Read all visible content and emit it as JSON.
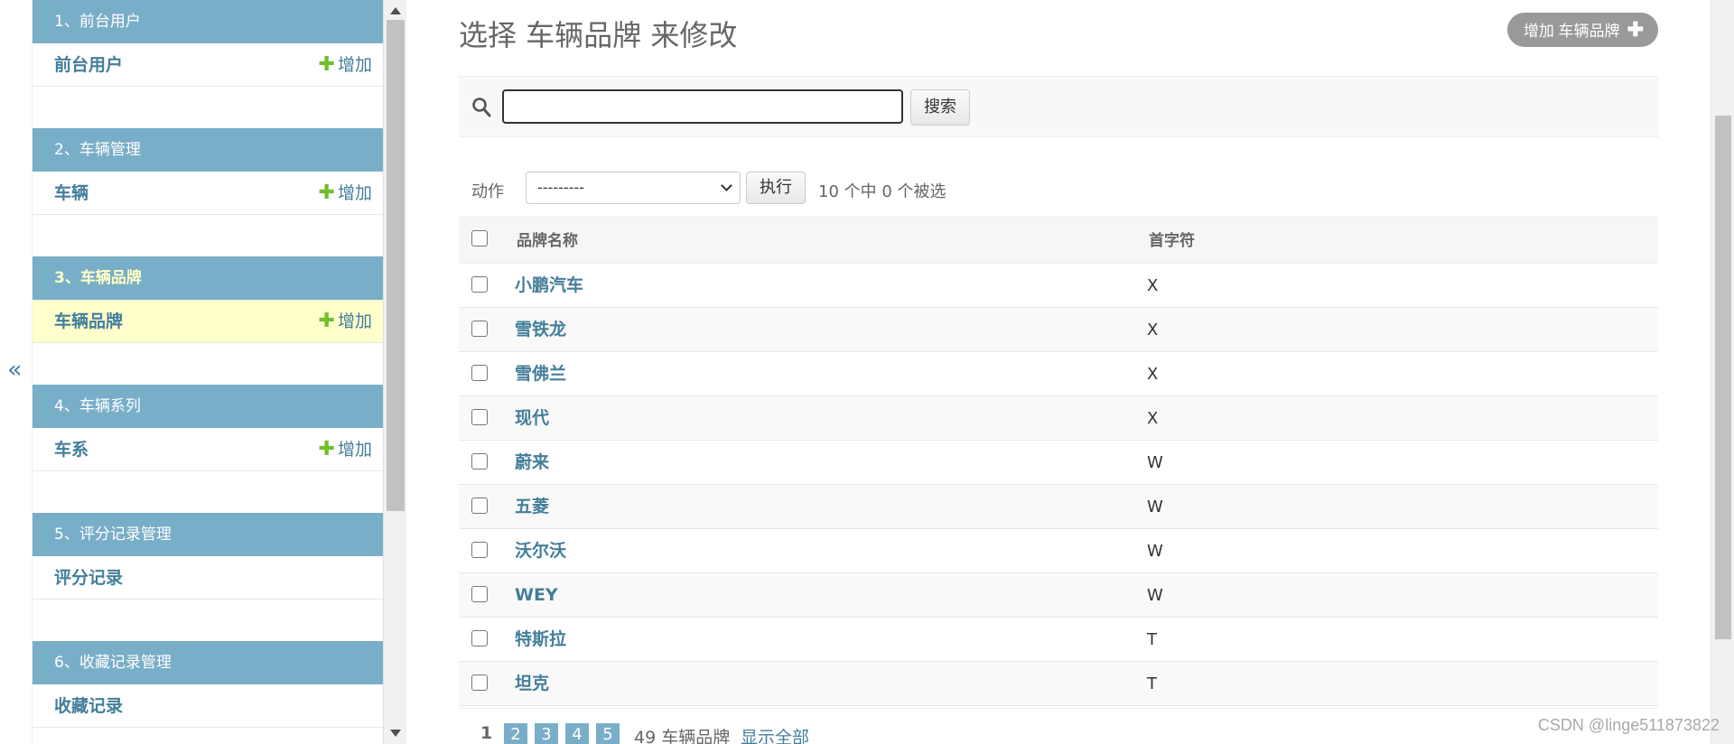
{
  "sidebar": {
    "collapse_label": "«",
    "modules": [
      {
        "caption": "1、前台用户",
        "model": "前台用户",
        "add_label": "增加",
        "active": false
      },
      {
        "caption": "2、车辆管理",
        "model": "车辆",
        "add_label": "增加",
        "active": false
      },
      {
        "caption": "3、车辆品牌",
        "model": "车辆品牌",
        "add_label": "增加",
        "active": true
      },
      {
        "caption": "4、车辆系列",
        "model": "车系",
        "add_label": "增加",
        "active": false
      },
      {
        "caption": "5、评分记录管理",
        "model": "评分记录",
        "add_label": "",
        "active": false
      },
      {
        "caption": "6、收藏记录管理",
        "model": "收藏记录",
        "add_label": "",
        "active": false
      }
    ]
  },
  "main": {
    "title": "选择 车辆品牌 来修改",
    "add_button_label": "增加 车辆品牌",
    "search": {
      "value": "",
      "button_label": "搜索"
    },
    "actions": {
      "label": "动作",
      "selected": "---------",
      "go_label": "执行",
      "counter": "10 个中 0 个被选"
    },
    "table": {
      "headers": [
        "品牌名称",
        "首字符"
      ],
      "rows": [
        {
          "name": "小鹏汽车",
          "initial": "X"
        },
        {
          "name": "雪铁龙",
          "initial": "X"
        },
        {
          "name": "雪佛兰",
          "initial": "X"
        },
        {
          "name": "现代",
          "initial": "X"
        },
        {
          "name": "蔚来",
          "initial": "W"
        },
        {
          "name": "五菱",
          "initial": "W"
        },
        {
          "name": "沃尔沃",
          "initial": "W"
        },
        {
          "name": "WEY",
          "initial": "W"
        },
        {
          "name": "特斯拉",
          "initial": "T"
        },
        {
          "name": "坦克",
          "initial": "T"
        }
      ]
    },
    "paginator": {
      "current": "1",
      "pages": [
        "2",
        "3",
        "4",
        "5"
      ],
      "count": "49 车辆品牌",
      "show_all": "显示全部"
    }
  },
  "watermark": "CSDN @linge511873822",
  "colors": {
    "caption_bg": "#79aec8",
    "link": "#447e9b",
    "active_row_bg": "#ffffcc",
    "add_plus": "#70bf2b"
  }
}
